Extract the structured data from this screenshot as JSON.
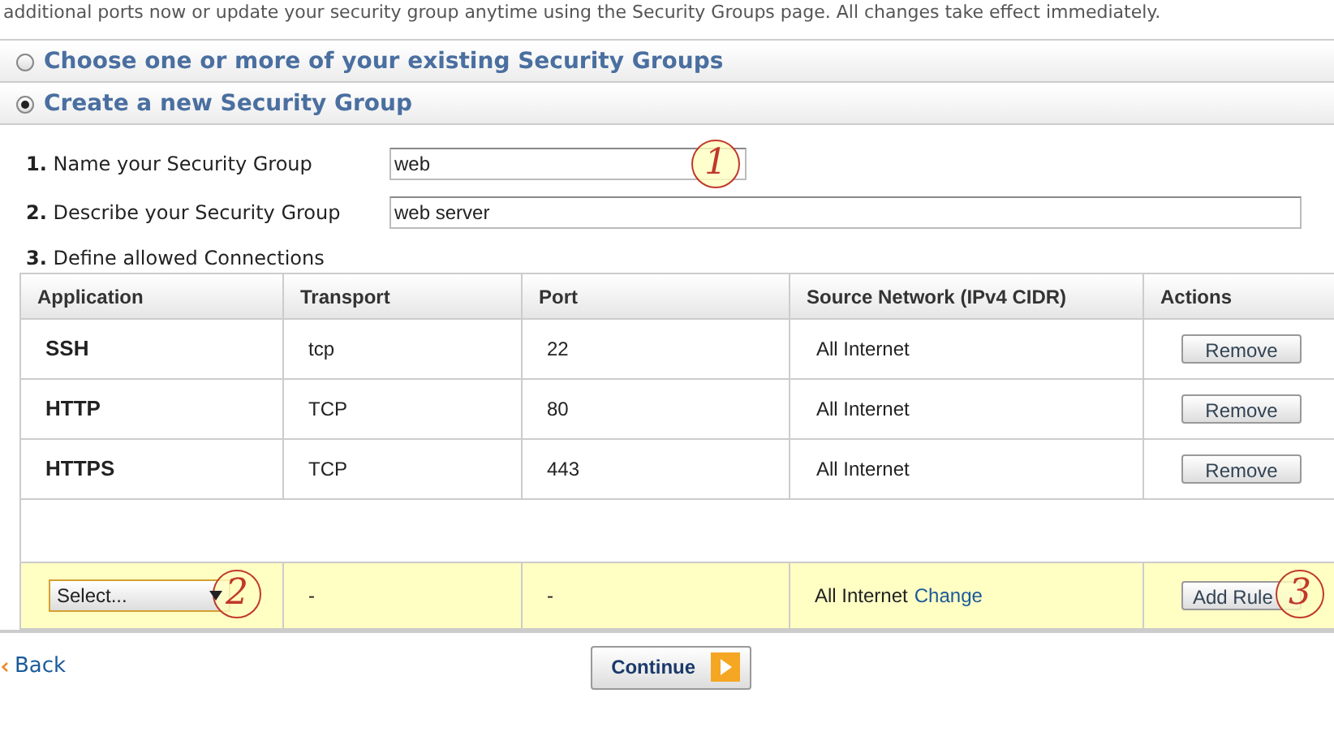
{
  "intro": "additional ports now or update your security group anytime using the Security Groups page. All changes take effect immediately.",
  "options": [
    {
      "label": "Choose one or more of your existing Security Groups",
      "selected": false
    },
    {
      "label": "Create a new Security Group",
      "selected": true
    }
  ],
  "fields": [
    {
      "number": "1.",
      "label": "Name your Security Group",
      "value": "web",
      "callout": "1"
    },
    {
      "number": "2.",
      "label": "Describe your Security Group",
      "value": "web server"
    }
  ],
  "connections_label": {
    "number": "3.",
    "label": "Define allowed Connections"
  },
  "table": {
    "columns": [
      "Application",
      "Transport",
      "Port",
      "Source Network (IPv4 CIDR)",
      "Actions"
    ],
    "rows": [
      {
        "application": "SSH",
        "transport": "tcp",
        "port": "22",
        "source": "All Internet",
        "action": "Remove"
      },
      {
        "application": "HTTP",
        "transport": "TCP",
        "port": "80",
        "source": "All Internet",
        "action": "Remove"
      },
      {
        "application": "HTTPS",
        "transport": "TCP",
        "port": "443",
        "source": "All Internet",
        "action": "Remove"
      }
    ],
    "new_rule": {
      "select": "Select...",
      "select_callout": "2",
      "transport": "-",
      "port": "-",
      "source": "All Internet",
      "change_link": "Change",
      "button": "Add Rule",
      "button_callout": "3"
    }
  },
  "back_link": "Back",
  "continue_button": "Continue"
}
